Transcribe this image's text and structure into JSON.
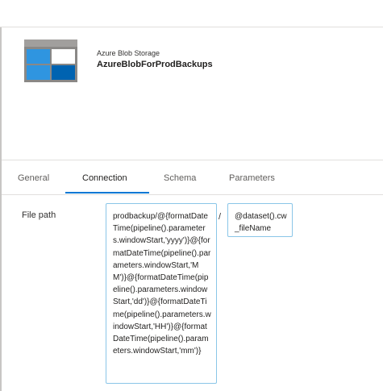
{
  "dataset": {
    "subtitle": "Azure Blob Storage",
    "name": "AzureBlobForProdBackups",
    "icon": "azure-blob-storage-icon"
  },
  "tabs": [
    {
      "label": "General",
      "active": false
    },
    {
      "label": "Connection",
      "active": true
    },
    {
      "label": "Schema",
      "active": false
    },
    {
      "label": "Parameters",
      "active": false
    }
  ],
  "connection": {
    "file_path_label": "File path",
    "directory_value": "prodbackup/@{formatDateTime(pipeline().parameters.windowStart,'yyyy')}@{formatDateTime(pipeline().parameters.windowStart,'MM')}@{formatDateTime(pipeline().parameters.windowStart,'dd')}@{formatDateTime(pipeline().parameters.windowStart,'HH')}@{formatDateTime(pipeline().parameters.windowStart,'mm')}",
    "separator": "/",
    "file_name_value": "@dataset().cw_fileName"
  },
  "colors": {
    "accent": "#0078d4",
    "input_border": "#8ac6e8",
    "icon_dark": "#0063b1",
    "icon_light": "#2f95e0",
    "icon_frame": "#8a8886"
  }
}
